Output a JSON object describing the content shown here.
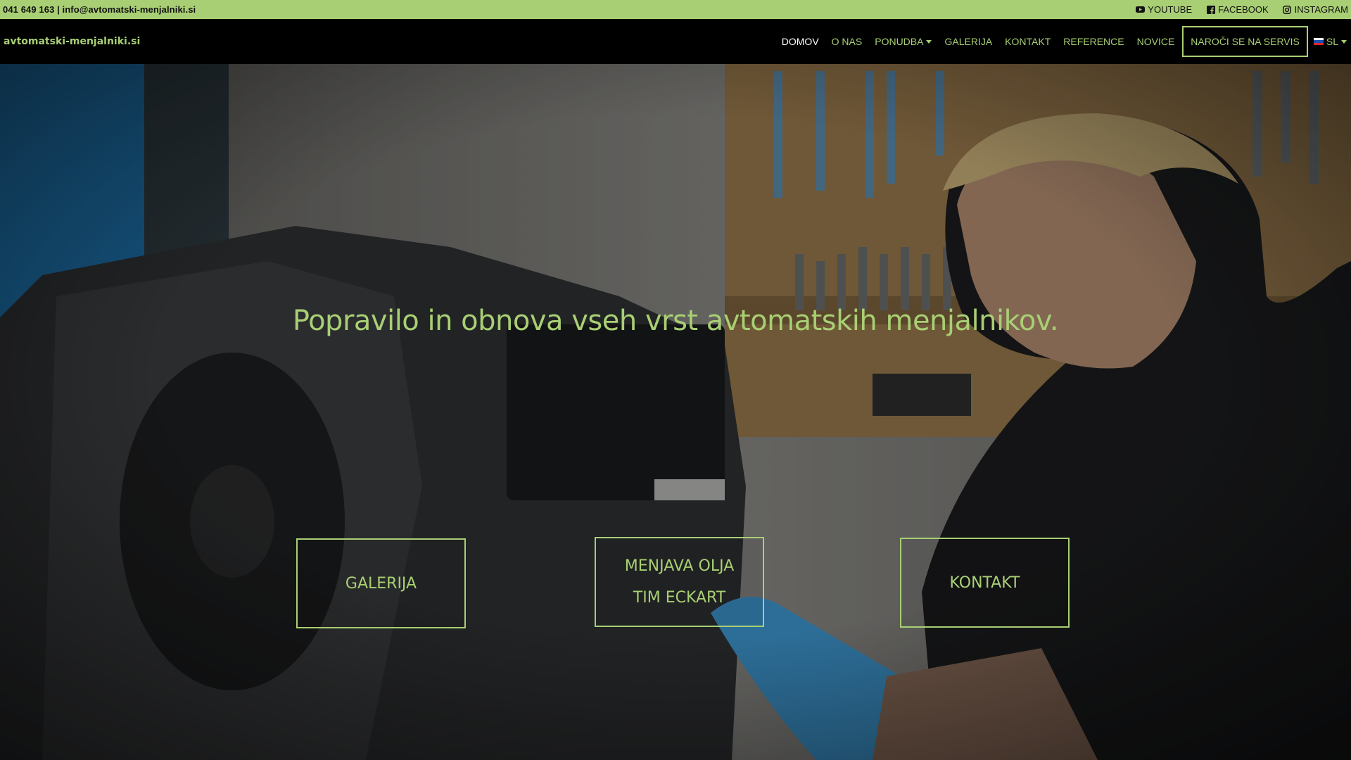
{
  "topbar": {
    "contact": "041 649 163 | info@avtomatski-menjalniki.si",
    "social": [
      {
        "label": "YOUTUBE",
        "icon": "youtube-icon"
      },
      {
        "label": "FACEBOOK",
        "icon": "facebook-icon"
      },
      {
        "label": "INSTAGRAM",
        "icon": "instagram-icon"
      }
    ],
    "bg_color": "#a9cf74"
  },
  "navbar": {
    "brand": "avtomatski-menjalniki.si",
    "items": [
      {
        "label": "DOMOV",
        "active": true
      },
      {
        "label": "O NAS"
      },
      {
        "label": "PONUDBA",
        "dropdown": true
      },
      {
        "label": "GALERIJA"
      },
      {
        "label": "KONTAKT"
      },
      {
        "label": "REFERENCE"
      },
      {
        "label": "NOVICE"
      }
    ],
    "cta": "NAROČI SE NA SERVIS",
    "language": {
      "label": "SL",
      "icon": "slovenia-flag-icon"
    },
    "accent_color": "#a9cf74"
  },
  "hero": {
    "headline": "Popravilo in obnova vseh vrst avtomatskih menjalnikov.",
    "buttons": [
      {
        "lines": [
          "GALERIJA"
        ]
      },
      {
        "lines": [
          "MENJAVA OLJA",
          "TIM ECKART"
        ]
      },
      {
        "lines": [
          "KONTAKT"
        ]
      }
    ]
  }
}
